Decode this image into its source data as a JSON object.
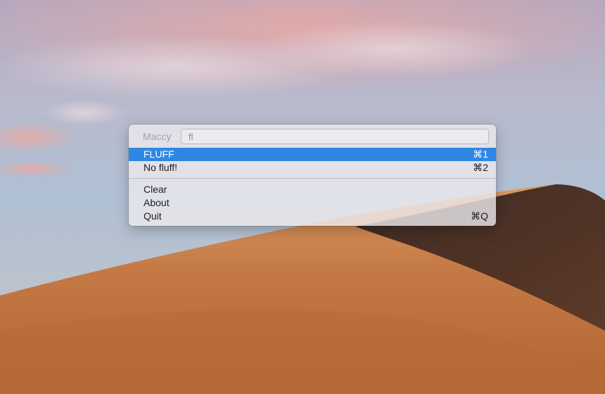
{
  "menu": {
    "app_title": "Maccy",
    "search": {
      "value": "fl",
      "placeholder": ""
    },
    "history": [
      {
        "label": "FLUFF",
        "shortcut": "⌘1",
        "selected": true
      },
      {
        "label": "No fluff!",
        "shortcut": "⌘2",
        "selected": false
      }
    ],
    "actions": [
      {
        "label": "Clear",
        "shortcut": ""
      },
      {
        "label": "About",
        "shortcut": ""
      },
      {
        "label": "Quit",
        "shortcut": "⌘Q"
      }
    ]
  },
  "colors": {
    "selection": "#2f87e4",
    "menu_background": "#eceaee",
    "dune": "#c77a42",
    "sky": "#aebdd3"
  }
}
